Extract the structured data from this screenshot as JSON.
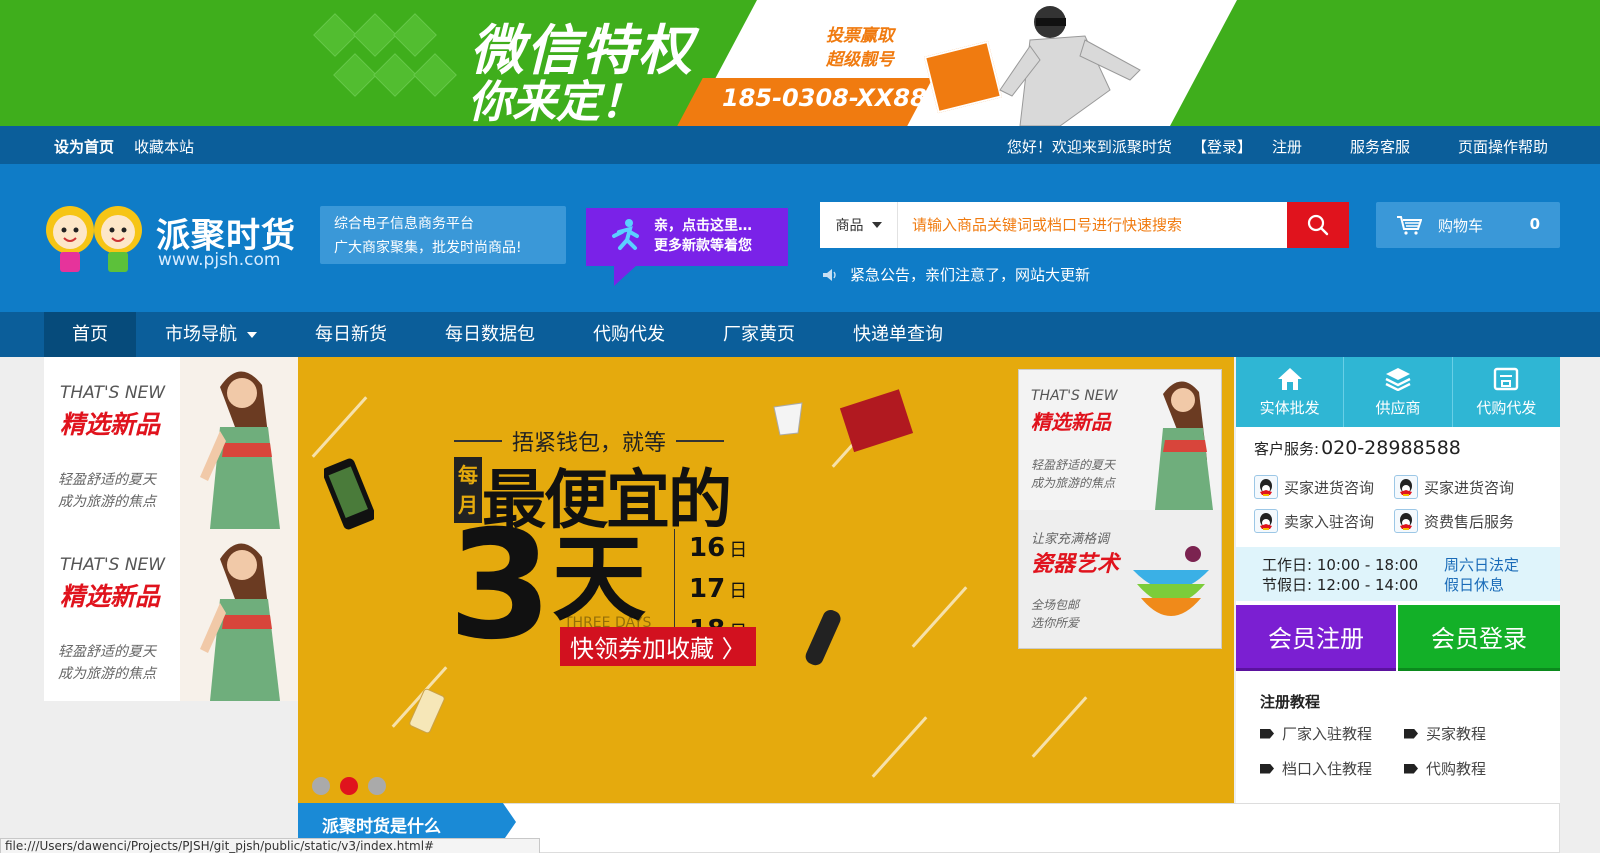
{
  "top_banner": {
    "title_line1": "微信特权",
    "title_line2": "你来定！",
    "promo_line1": "投票赢取",
    "promo_line2": "超级靓号",
    "phone": "185-0308-XX88"
  },
  "topbar": {
    "set_home": "设为首页",
    "bookmark": "收藏本站",
    "welcome": "您好！欢迎来到派聚时货",
    "login": "【登录】",
    "register": "注册",
    "service": "服务客服",
    "help": "页面操作帮助"
  },
  "header": {
    "logo_name": "派聚时货",
    "logo_url": "www.pjsh.com",
    "slogan_line1": "综合电子信息商务平台",
    "slogan_line2": "广大商家聚集，批发时尚商品!",
    "bubble_line1": "亲，点击这里…",
    "bubble_line2": "更多新款等着您",
    "search_category": "商品",
    "search_placeholder": "请输入商品关键词或档口号进行快速搜索",
    "notice": "紧急公告，亲们注意了，网站大更新",
    "cart_label": "购物车",
    "cart_count": "0"
  },
  "nav": {
    "items": [
      "首页",
      "市场导航",
      "每日新货",
      "每日数据包",
      "代购代发",
      "厂家黄页",
      "快递单查询"
    ]
  },
  "left_ads": [
    {
      "en": "THAT'S NEW",
      "cn": "精选新品",
      "sub1": "轻盈舒适的夏天",
      "sub2": "成为旅游的焦点"
    },
    {
      "en": "THAT'S NEW",
      "cn": "精选新品",
      "sub1": "轻盈舒适的夏天",
      "sub2": "成为旅游的焦点"
    }
  ],
  "carousel": {
    "headline1": "捂紧钱包，就等",
    "monthly": "每月",
    "headline2": "最便宜的",
    "big_number": "3",
    "day_word": "天",
    "three_days": "THREE DAYS",
    "date1": "16",
    "date2": "17",
    "date3": "18",
    "day_char": "日",
    "coupon": "快领券加收藏 〉",
    "inner_ad1": {
      "en": "THAT'S NEW",
      "cn": "精选新品",
      "sub1": "轻盈舒适的夏天",
      "sub2": "成为旅游的焦点"
    },
    "inner_ad2": {
      "top": "让家充满格调",
      "cn": "瓷器艺术",
      "sub1": "全场包邮",
      "sub2": "选你所爱"
    },
    "active_slide": 2,
    "slide_count": 3
  },
  "side": {
    "tabs": [
      "实体批发",
      "供应商",
      "代购代发"
    ],
    "phone_label": "客户服务:",
    "phone": "020-28988588",
    "qq": [
      "买家进货咨询",
      "买家进货咨询",
      "卖家入驻咨询",
      "资费售后服务"
    ],
    "workday": "工作日:  10:00 - 18:00",
    "holiday": "节假日:  12:00 - 14:00",
    "note1": "周六日法定",
    "note2": "假日休息",
    "register_btn": "会员注册",
    "login_btn": "会员登录",
    "tutorial_title": "注册教程",
    "tutorials": [
      "厂家入驻教程",
      "买家教程",
      "档口入住教程",
      "代购教程"
    ]
  },
  "section_tab": "派聚时货是什么",
  "status_url": "file:///Users/dawenci/Projects/PJSH/git_pjsh/public/static/v3/index.html#",
  "colors": {
    "banner_green": "#3fae1c",
    "nav_blue": "#0b5e9a",
    "header_blue": "#0f7cc7",
    "accent_red": "#e0131d",
    "purple": "#7b1fd2",
    "green_btn": "#13b028",
    "carousel_yellow": "#e5aa0d"
  }
}
